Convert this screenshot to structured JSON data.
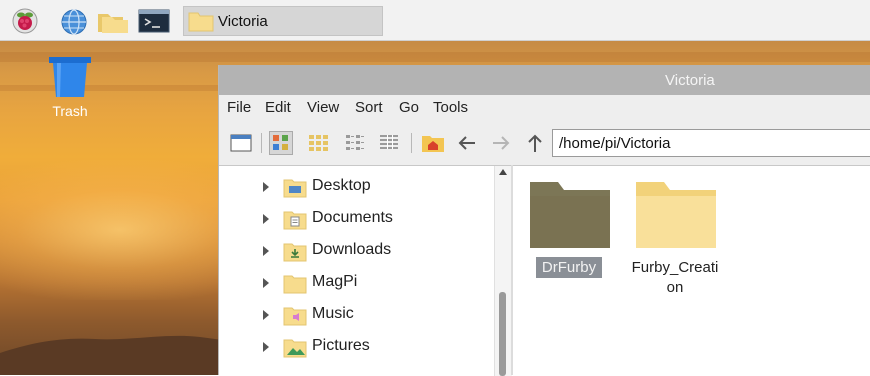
{
  "taskbar": {
    "launchers": [
      "raspberry-menu-icon",
      "web-browser-icon",
      "file-manager-icon",
      "terminal-icon"
    ],
    "window_button_label": "Victoria"
  },
  "desktop": {
    "trash_label": "Trash"
  },
  "file_manager": {
    "title": "Victoria",
    "menu": [
      "File",
      "Edit",
      "View",
      "Sort",
      "Go",
      "Tools"
    ],
    "path": "/home/pi/Victoria",
    "sidebar_items": [
      {
        "label": "Desktop",
        "icon": "desktop-folder-icon"
      },
      {
        "label": "Documents",
        "icon": "documents-folder-icon"
      },
      {
        "label": "Downloads",
        "icon": "downloads-folder-icon"
      },
      {
        "label": "MagPi",
        "icon": "folder-icon"
      },
      {
        "label": "Music",
        "icon": "music-folder-icon"
      },
      {
        "label": "Pictures",
        "icon": "pictures-folder-icon"
      }
    ],
    "files": [
      {
        "name": "DrFurby",
        "selected": true
      },
      {
        "name_line1": "Furby_Creati",
        "name_line2": "on",
        "selected": false
      }
    ]
  },
  "colors": {
    "taskbar_bg": "#f2f2f2",
    "titlebar_bg": "#b3b3b3",
    "selection_bg": "#8a8f96",
    "folder_yellow": "#f7dc8d",
    "folder_dark": "#7c7656"
  }
}
